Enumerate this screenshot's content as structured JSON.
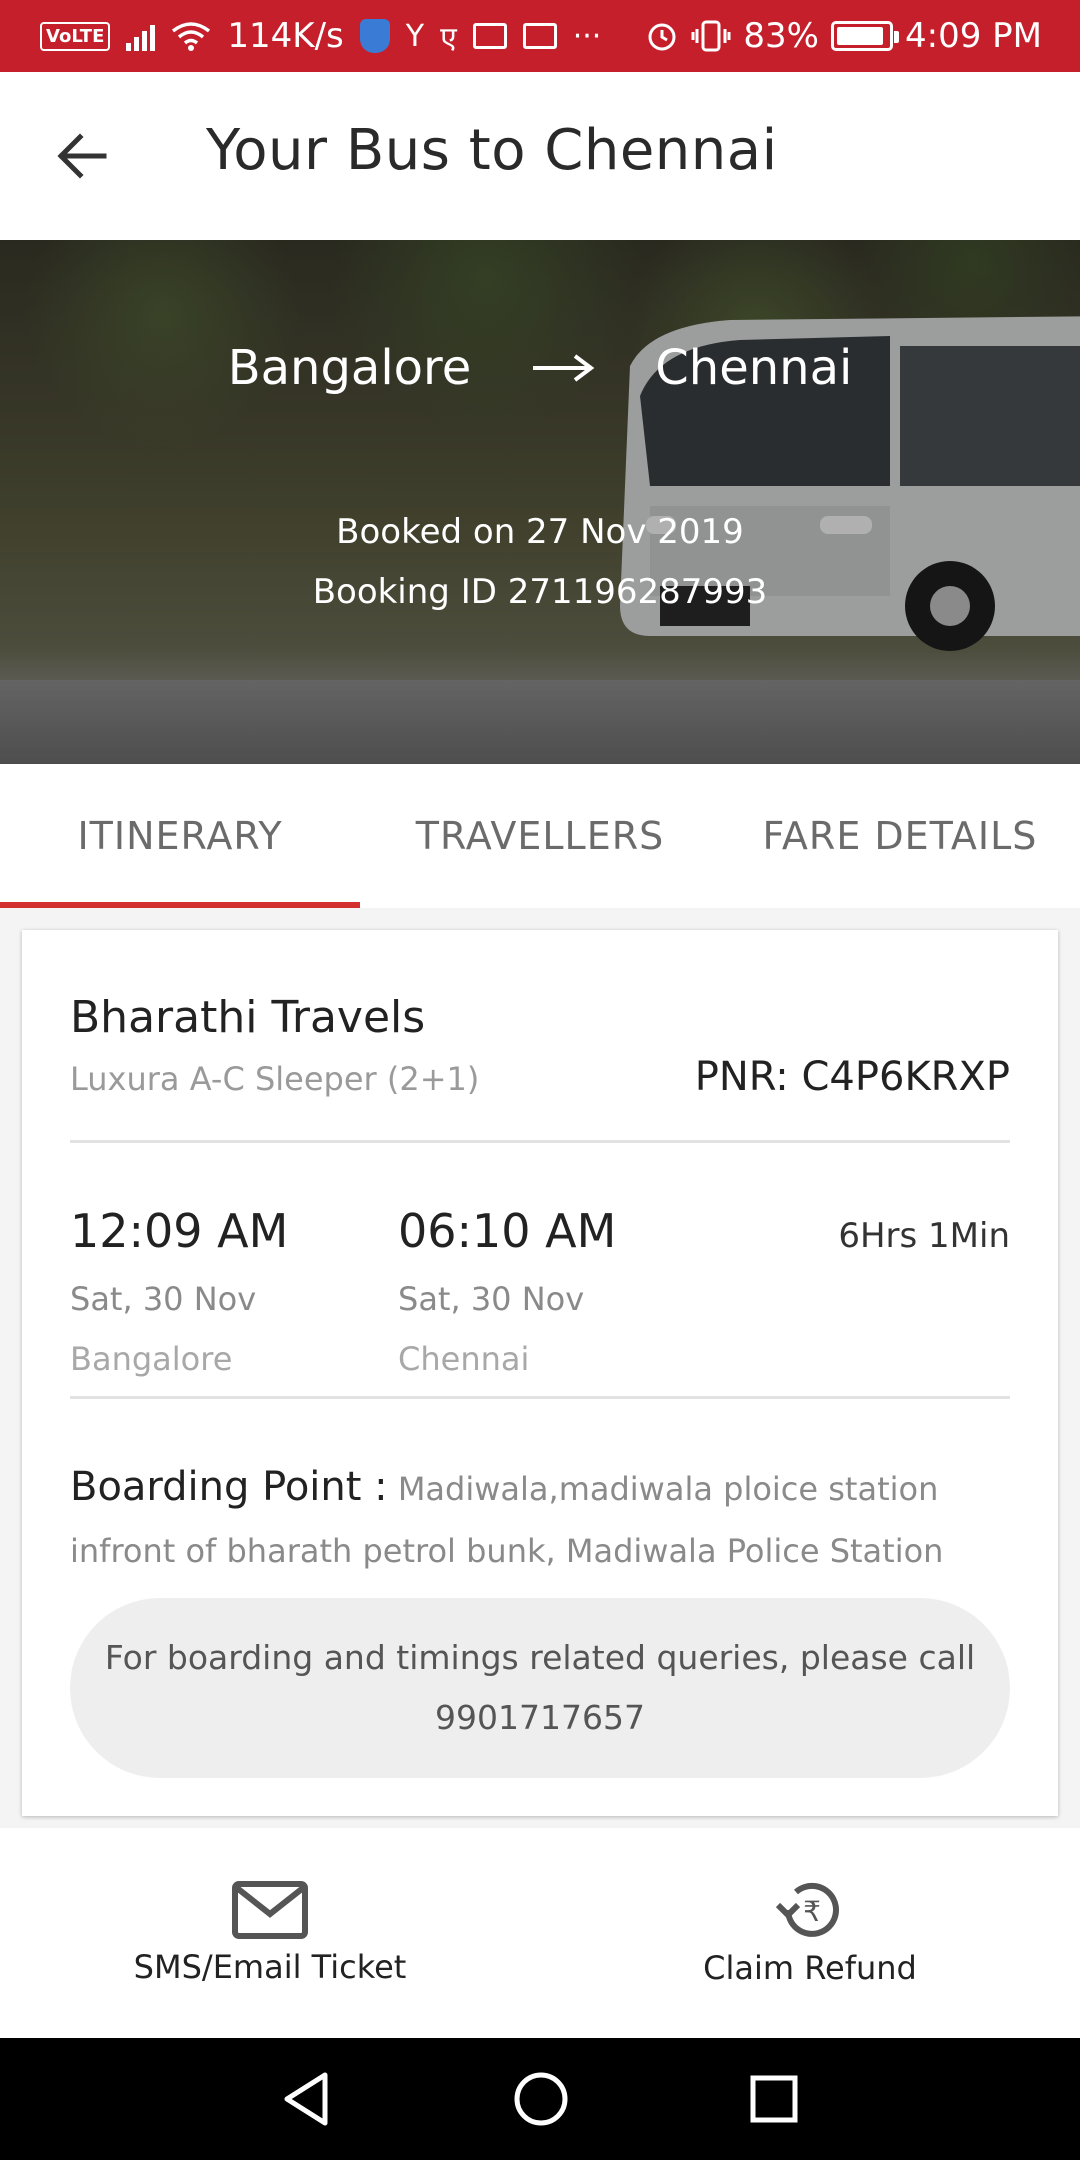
{
  "status_bar": {
    "volte": "VoLTE",
    "speed": "114K/s",
    "battery": "83%",
    "time": "4:09 PM",
    "carrier_glyph": "Y",
    "rupee_glyph": "ए",
    "more": "···"
  },
  "app_bar": {
    "title": "Your Bus to Chennai"
  },
  "hero": {
    "from": "Bangalore",
    "to": "Chennai",
    "booked_on": "Booked on 27 Nov 2019",
    "booking_id": "Booking ID 271196287993"
  },
  "tabs": [
    {
      "label": "ITINERARY",
      "active": true
    },
    {
      "label": "TRAVELLERS",
      "active": false
    },
    {
      "label": "FARE DETAILS",
      "active": false
    }
  ],
  "itinerary": {
    "operator": "Bharathi Travels",
    "bus_type": "Luxura A-C Sleeper (2+1)",
    "pnr": "PNR: C4P6KRXP",
    "departure": {
      "time": "12:09 AM",
      "date": "Sat, 30 Nov",
      "city": "Bangalore"
    },
    "arrival": {
      "time": "06:10 AM",
      "date": "Sat, 30 Nov",
      "city": "Chennai"
    },
    "duration": "6Hrs 1Min",
    "boarding_label": "Boarding Point :",
    "boarding_point": "Madiwala,madiwala ploice station infront of bharath petrol bunk, Madiwala Police Station",
    "query_line1": "For boarding and timings related queries, please call",
    "query_phone": "9901717657"
  },
  "actions": {
    "sms_email": "SMS/Email Ticket",
    "claim_refund": "Claim Refund"
  },
  "colors": {
    "status_bar": "#c51f2b",
    "tab_indicator": "#d32f2f"
  }
}
